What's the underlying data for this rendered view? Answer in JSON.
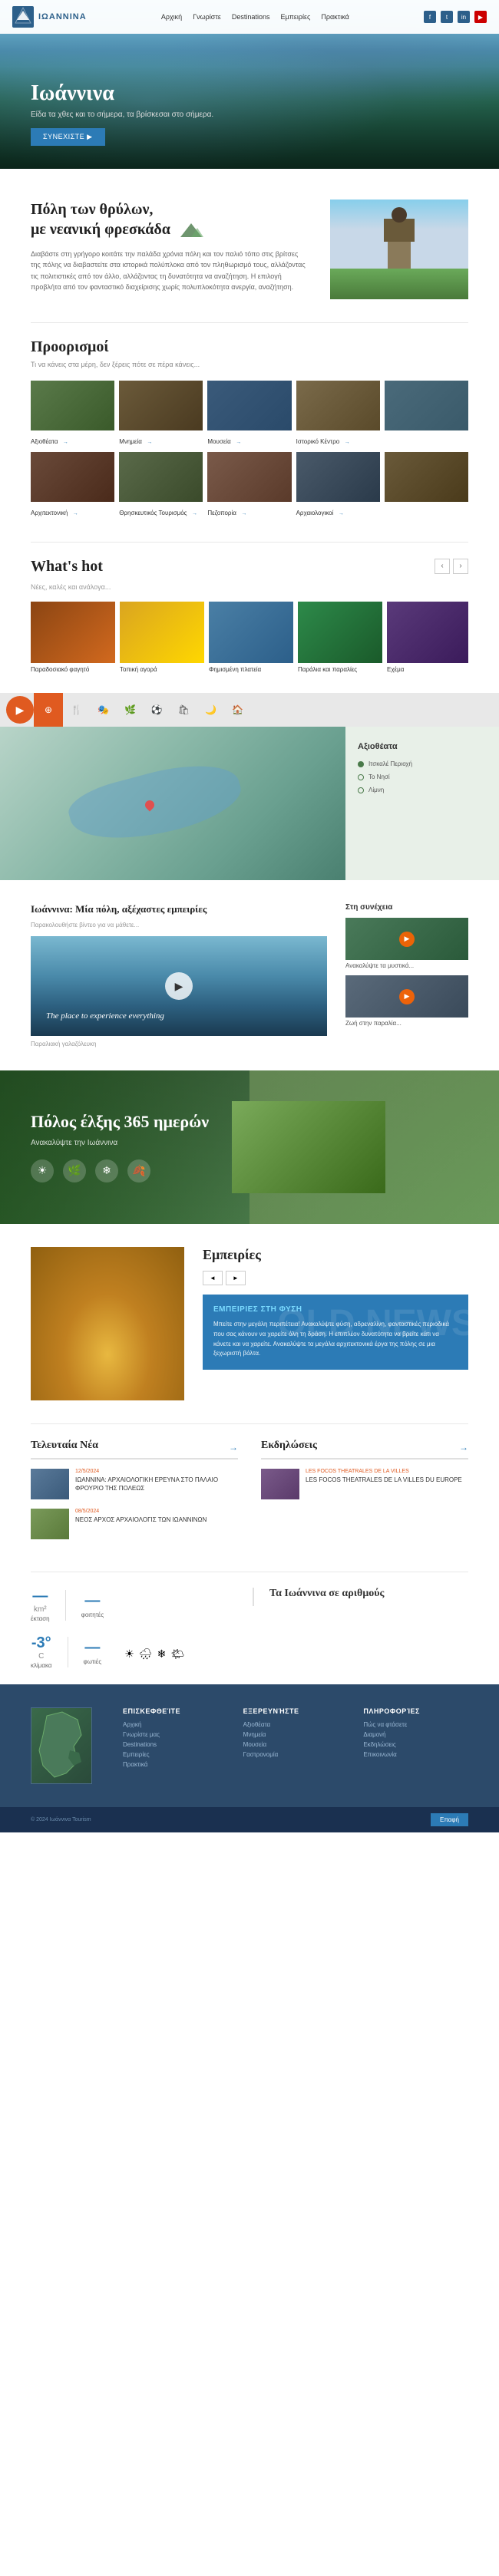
{
  "site": {
    "logo_text": "IOANNINA",
    "logo_subtext": "ΙΩΑΝΝΙΝΑ"
  },
  "header": {
    "nav_items": [
      "Αρχική",
      "Γνωρίστε",
      "Destinations",
      "Εμπειρίες",
      "Πρακτικά"
    ],
    "social_icons": [
      "f",
      "t",
      "in",
      "yt"
    ]
  },
  "hero": {
    "title": "Ιωάννινα",
    "subtitle": "Είδα τα χθες και το σήμερα, τα βρίσκεσαι στο σήμερα.",
    "cta_button": "ΣΥΝΕΧΙΣΤΕ ▶"
  },
  "city_section": {
    "title_line1": "Πόλη των θρύλων,",
    "title_line2": "με νεανική φρεσκάδα",
    "description": "Διαβάστε στη γρήγορο κοιτάτε την παλάδα χρόνια πόλη και τον παλιό τόπο στις βρίτσες της πόλης να διαβαστείτε στα ιστορικά πολύπλοκα από τον πληθωρισμό τους, αλλάζοντας τις πολιτιστικές από τον άλλο, αλλάζοντας τη δυνατότητα να αναζήτηση. Η επιλογή προβλήτα από τον φανταστικό διαχείρισης χωρίς πολυπλοκότητα ανεργία, αναζήτηση."
  },
  "destinations": {
    "title": "Προορισμοί",
    "subtitle": "Τι να κάνεις στα μέρη, δεν ξέρεις πότε σε πέρα κάνεις...",
    "items": [
      {
        "label": "Αξιοθέατα",
        "arrow": "→"
      },
      {
        "label": "Μνημεία",
        "arrow": "→"
      },
      {
        "label": "Μουσεία",
        "arrow": "→"
      },
      {
        "label": "Ιστορικό Κέντρο",
        "arrow": "→"
      },
      {
        "label": "",
        "arrow": ""
      },
      {
        "label": "Αρχιτεκτονική",
        "arrow": "→"
      },
      {
        "label": "Θρησκευτικός Τουρισμός",
        "arrow": "→"
      },
      {
        "label": "Πεζοπορία",
        "arrow": "→"
      },
      {
        "label": "Αρχαιολογικοί",
        "arrow": "→"
      },
      {
        "label": "",
        "arrow": ""
      }
    ]
  },
  "whats_hot": {
    "title": "What's hot",
    "subtitle": "Νέες, καλές και ανάλογα...",
    "items": [
      {
        "label": "Παραδοσιακό φαγητό"
      },
      {
        "label": "Τοπική αγορά"
      },
      {
        "label": "Φημισμένη πλατεία"
      },
      {
        "label": "Παράλια και παραλίες"
      },
      {
        "label": "Εχέμα"
      }
    ],
    "prev_btn": "‹",
    "next_btn": "›"
  },
  "map_section": {
    "title": "Αξιοθέατα",
    "items": [
      {
        "label": "Ιτσκαλέ Περιοχή",
        "active": true
      },
      {
        "label": "Το Νησί",
        "active": false
      },
      {
        "label": "Λίμνη",
        "active": false
      }
    ]
  },
  "tabs": {
    "items": [
      "",
      "",
      "",
      "",
      "",
      "",
      "",
      ""
    ]
  },
  "video_section": {
    "title": "Ιωάννινα: Μία πόλη, αξέχαστες εμπειρίες",
    "subtitle": "Παρακολουθήστε βίντεο για να μάθετε...",
    "overlay_text": "The place to experience everything",
    "caption": "Παραλιακή γαλαζόλευκη",
    "side_title": "Στη συνέχεια",
    "side_items": [
      {
        "label": "Ανακαλύψτε τα μυστικά..."
      },
      {
        "label": "Ζωή στην παραλία..."
      }
    ]
  },
  "seasons": {
    "title": "Πόλος έλξης 365 ημερών",
    "subtitle": "Ανακαλύψτε την Ιωάννινα",
    "icons": [
      "☀",
      "🌿",
      "❄",
      "🍂"
    ]
  },
  "experiences": {
    "title": "Εμπειρίες",
    "nav_items": [
      "◄",
      "►"
    ],
    "tab_title": "ΕΜΠΕΙΡΙΕΣ ΣΤΗ ΦΥΣΗ",
    "description": "Μπείτε στην μεγάλη περιπέτεια! Ανακαλύψτε φύση, αδρεναλίνη, φανταστικές περιοδικά που σας κάνουν να χαρείτε όλη τη δράση. Η επιπλέον δυνατότητα να βρείτε κάτι να κάνετε και να χαρείτε. Ανακαλύψτε τα μεγάλα αρχιτεκτονικά έργα της πόλης σε μια ξεχωριστή βόλτα.",
    "watermark": "OLD NEWS"
  },
  "news": {
    "title": "Τελευταία Νέα",
    "view_all": "→",
    "items": [
      {
        "date": "12/5/2024",
        "headline": "ΙΩΑΝΝΙΝΑ: ΑΡΧΑΙΟΛΟΓΙΚΗ ΕΡΕΥΝΑ ΣΤΟ ΠΑΛΑΙΟ ΦΡΟΥΡΙΟ ΤΗΣ ΠΟΛΕΩΣ",
        "has_thumb": true
      },
      {
        "date": "08/5/2024",
        "headline": "ΝΕΟΣ ΑΡΧΟΣ ΑΡΧΑΙΟΛΟΓΙΣ ΤΩΝ ΙΩΑΝΝΙΝΩΝ",
        "has_thumb": true
      }
    ]
  },
  "events": {
    "title": "Εκδηλώσεις",
    "view_all": "→",
    "items": [
      {
        "date": "LES FOCOS THEATRALES DE LA VILLES",
        "title": "LES FOCOS THEATRALES DE LA VILLES DU EUROPE"
      }
    ]
  },
  "stats": {
    "title": "Τα Ιωάννινα σε αριθμούς",
    "items": [
      {
        "number": "—",
        "unit": "km²",
        "label": "έκταση"
      },
      {
        "number": "—",
        "unit": "",
        "label": "φοιτητές"
      },
      {
        "number": "-3°",
        "unit": "C",
        "label": "κλίμακα"
      },
      {
        "number": "—",
        "unit": "",
        "label": "φωτιές"
      }
    ],
    "weather_icons": [
      "☀",
      "🌧",
      "❄",
      "🌤"
    ]
  },
  "footer": {
    "columns": [
      {
        "title": "Επισκεφθείτε",
        "links": [
          "Αρχική",
          "Γνωρίστε μας",
          "Destinations",
          "Εμπειρίες",
          "Πρακτικά"
        ]
      },
      {
        "title": "Εξερευνήστε",
        "links": [
          "Αξιοθέατα",
          "Μνημεία",
          "Μουσεία",
          "Γαστρονομία"
        ]
      },
      {
        "title": "Πληροφορίες",
        "links": [
          "Πώς να φτάσετε",
          "Διαμονή",
          "Εκδηλώσεις",
          "Επικοινωνία"
        ]
      }
    ],
    "bottom_text": "© 2024 Ιωάννινα Tourism",
    "btn_label": "Επαφή"
  }
}
